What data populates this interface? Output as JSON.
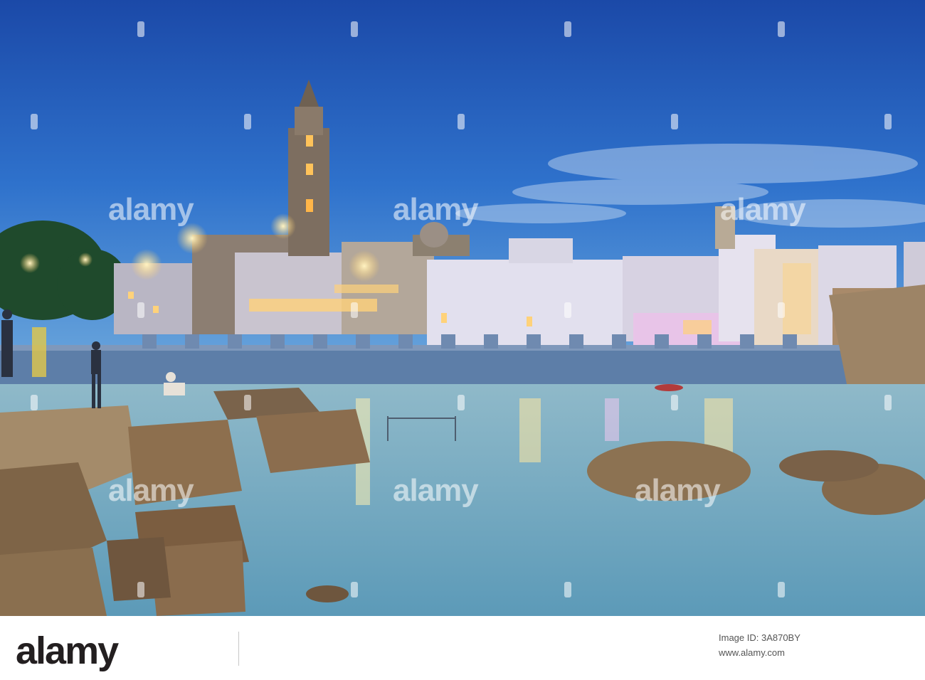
{
  "photo": {
    "subject": "Evening harbour waterfront with cathedral bell tower and rocky shore",
    "colors": {
      "sky_top": "#1f54b5",
      "sky_mid": "#3f86d6",
      "sky_horizon": "#5a9bd8",
      "water": "#6aa7c4",
      "water_light": "#9cc7d6",
      "rocks": "#8a6a48",
      "seawall": "#5f7fa8",
      "buildings": "#d9d6e8",
      "lights": "#ffd27a"
    }
  },
  "watermark": {
    "text": "alamy"
  },
  "footer": {
    "brand": "alamy",
    "image_id": "Image ID: 3A870BY",
    "site": "www.alamy.com"
  }
}
